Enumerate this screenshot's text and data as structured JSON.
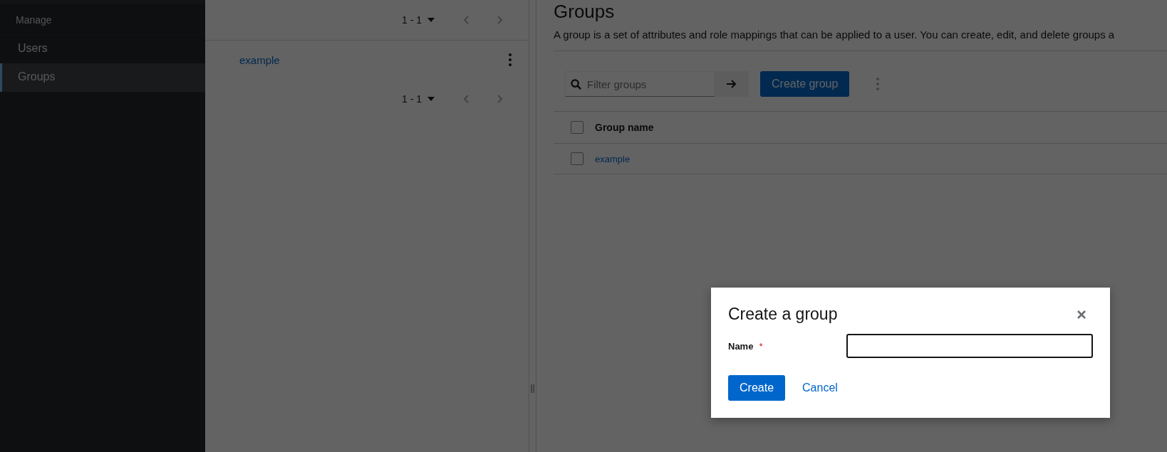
{
  "sidebar": {
    "section": "Manage",
    "items": [
      {
        "label": "Users",
        "selected": false
      },
      {
        "label": "Groups",
        "selected": true
      }
    ]
  },
  "tree": {
    "pagination_top": {
      "range": "1 - 1"
    },
    "items": [
      {
        "label": "example"
      }
    ],
    "pagination_bottom": {
      "range": "1 - 1"
    }
  },
  "groups": {
    "title": "Groups",
    "description": "A group is a set of attributes and role mappings that can be applied to a user. You can create, edit, and delete groups a",
    "search": {
      "placeholder": "Filter groups"
    },
    "create_button": "Create group",
    "table": {
      "header": {
        "label": "Group name",
        "checked": false
      },
      "rows": [
        {
          "name": "example",
          "checked": false
        }
      ]
    }
  },
  "modal": {
    "title": "Create a group",
    "fields": [
      {
        "label": "Name",
        "required_mark": "*"
      }
    ],
    "buttons": [
      {
        "label": "Create",
        "kind": "primary"
      },
      {
        "label": "Cancel",
        "kind": "link"
      }
    ]
  }
}
